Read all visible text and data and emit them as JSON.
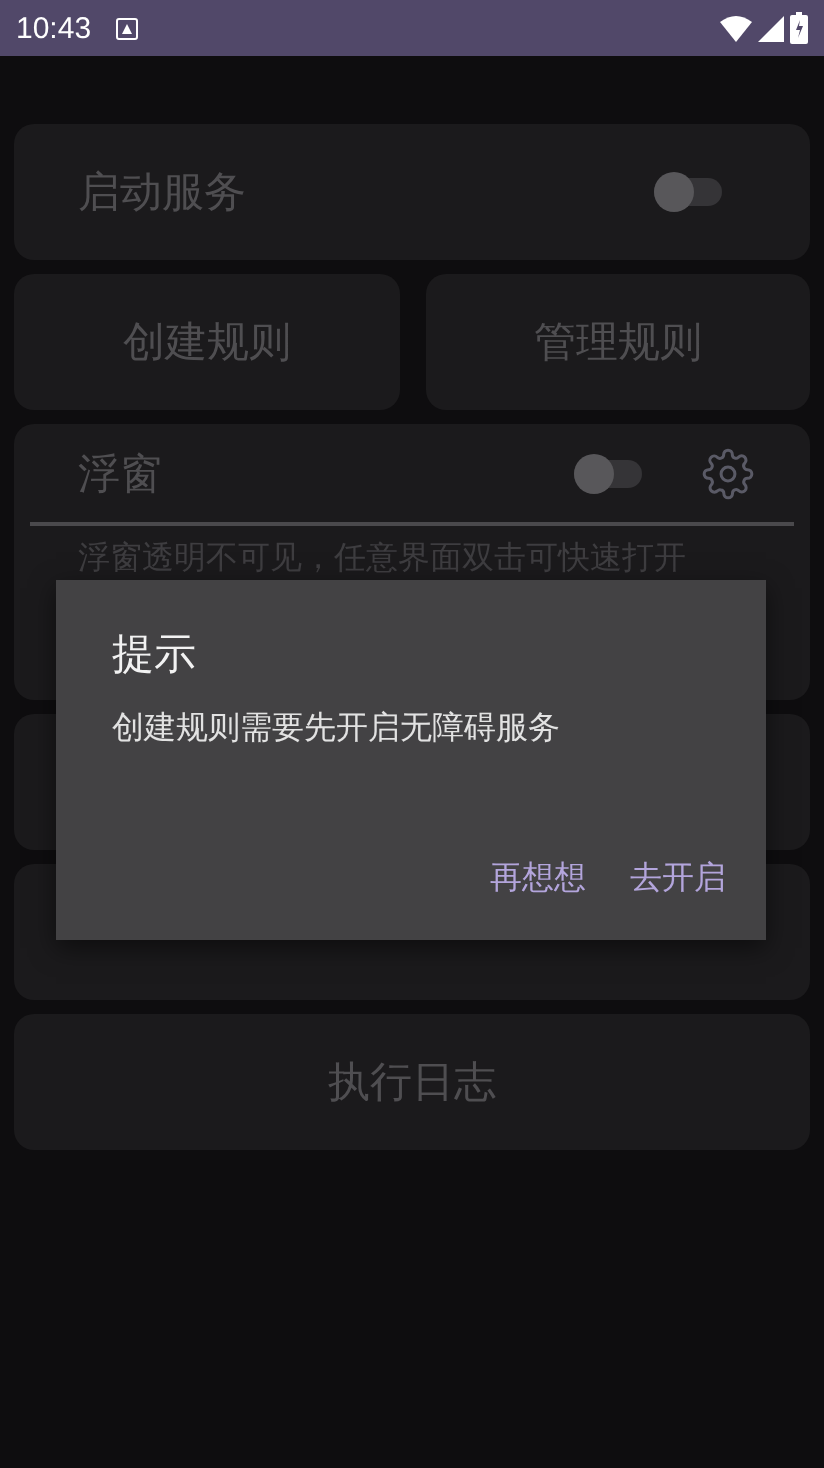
{
  "status_bar": {
    "time": "10:43"
  },
  "service": {
    "label": "启动服务",
    "on": false
  },
  "rule_buttons": [
    "创建规则",
    "管理规则"
  ],
  "float_window": {
    "label": "浮窗",
    "on": false,
    "hint": "浮窗透明不可见，任意界面双击可快速打开"
  },
  "menu_cards": [
    {
      "label": "执行日志"
    }
  ],
  "dialog": {
    "title": "提示",
    "message": "创建规则需要先开启无障碍服务",
    "buttons": [
      "再想想",
      "去开启"
    ]
  }
}
